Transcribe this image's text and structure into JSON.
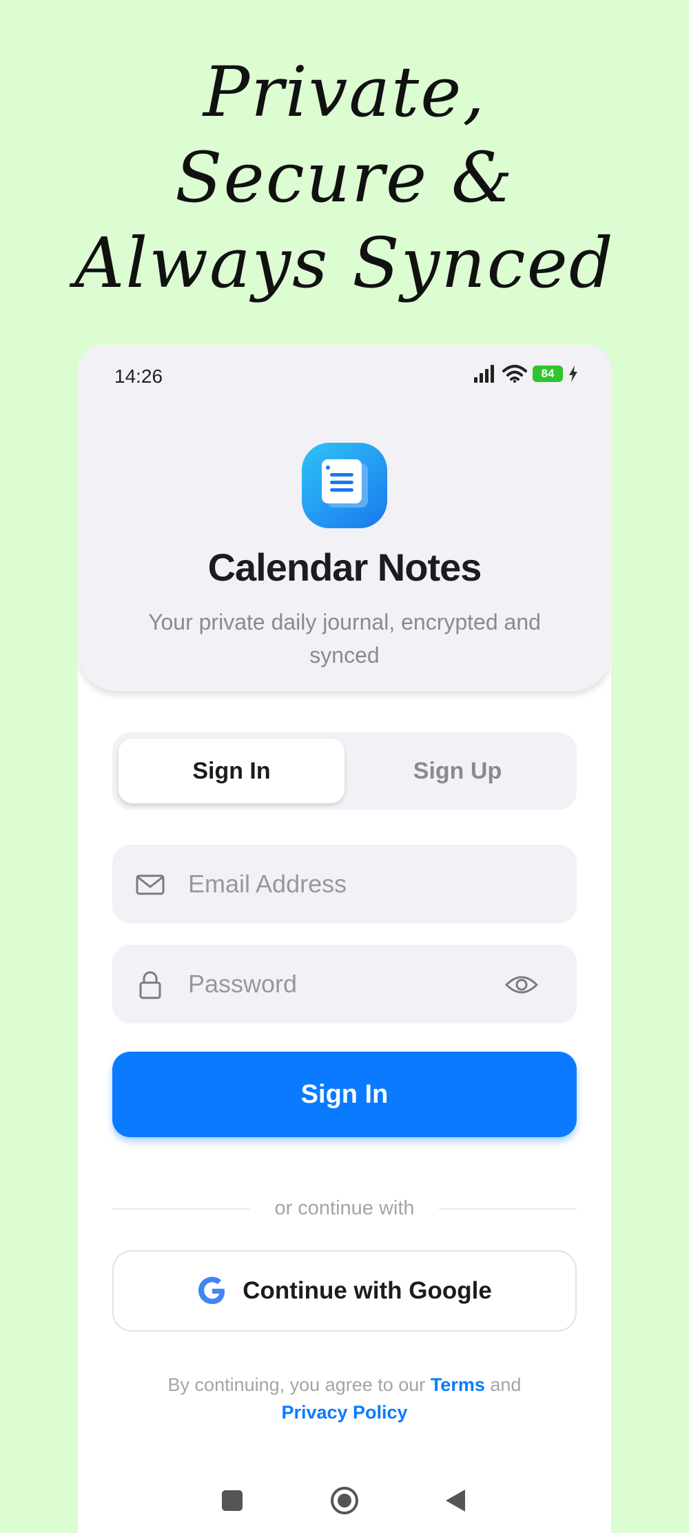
{
  "headline": {
    "lines": [
      "Private,",
      "Secure &",
      "Always Synced"
    ]
  },
  "status_bar": {
    "time": "14:26",
    "battery": "84",
    "icons": [
      "signal-icon",
      "wifi-icon",
      "battery-icon",
      "charging-icon"
    ]
  },
  "app": {
    "icon": "notes-app-icon",
    "title": "Calendar Notes",
    "subtitle": "Your private daily journal, encrypted and synced"
  },
  "tabs": [
    {
      "label": "Sign In",
      "selected": true
    },
    {
      "label": "Sign Up",
      "selected": false
    }
  ],
  "form": {
    "email": {
      "placeholder": "Email Address",
      "value": "",
      "icon": "envelope-icon"
    },
    "password": {
      "placeholder": "Password",
      "value": "",
      "icon": "lock-icon",
      "toggle_icon": "eye-icon"
    },
    "submit_label": "Sign In"
  },
  "divider_text": "or continue with",
  "google_button": {
    "label": "Continue with Google",
    "icon": "google-icon"
  },
  "legal": {
    "prefix": "By continuing, you agree to our",
    "terms": "Terms",
    "conjunction": "and",
    "privacy": "Privacy Policy"
  },
  "colors": {
    "background": "#dcfcd2",
    "accent": "#0a7bff",
    "battery": "#2ec52e"
  },
  "nav_bar": [
    "recents-button",
    "home-button",
    "back-button"
  ]
}
